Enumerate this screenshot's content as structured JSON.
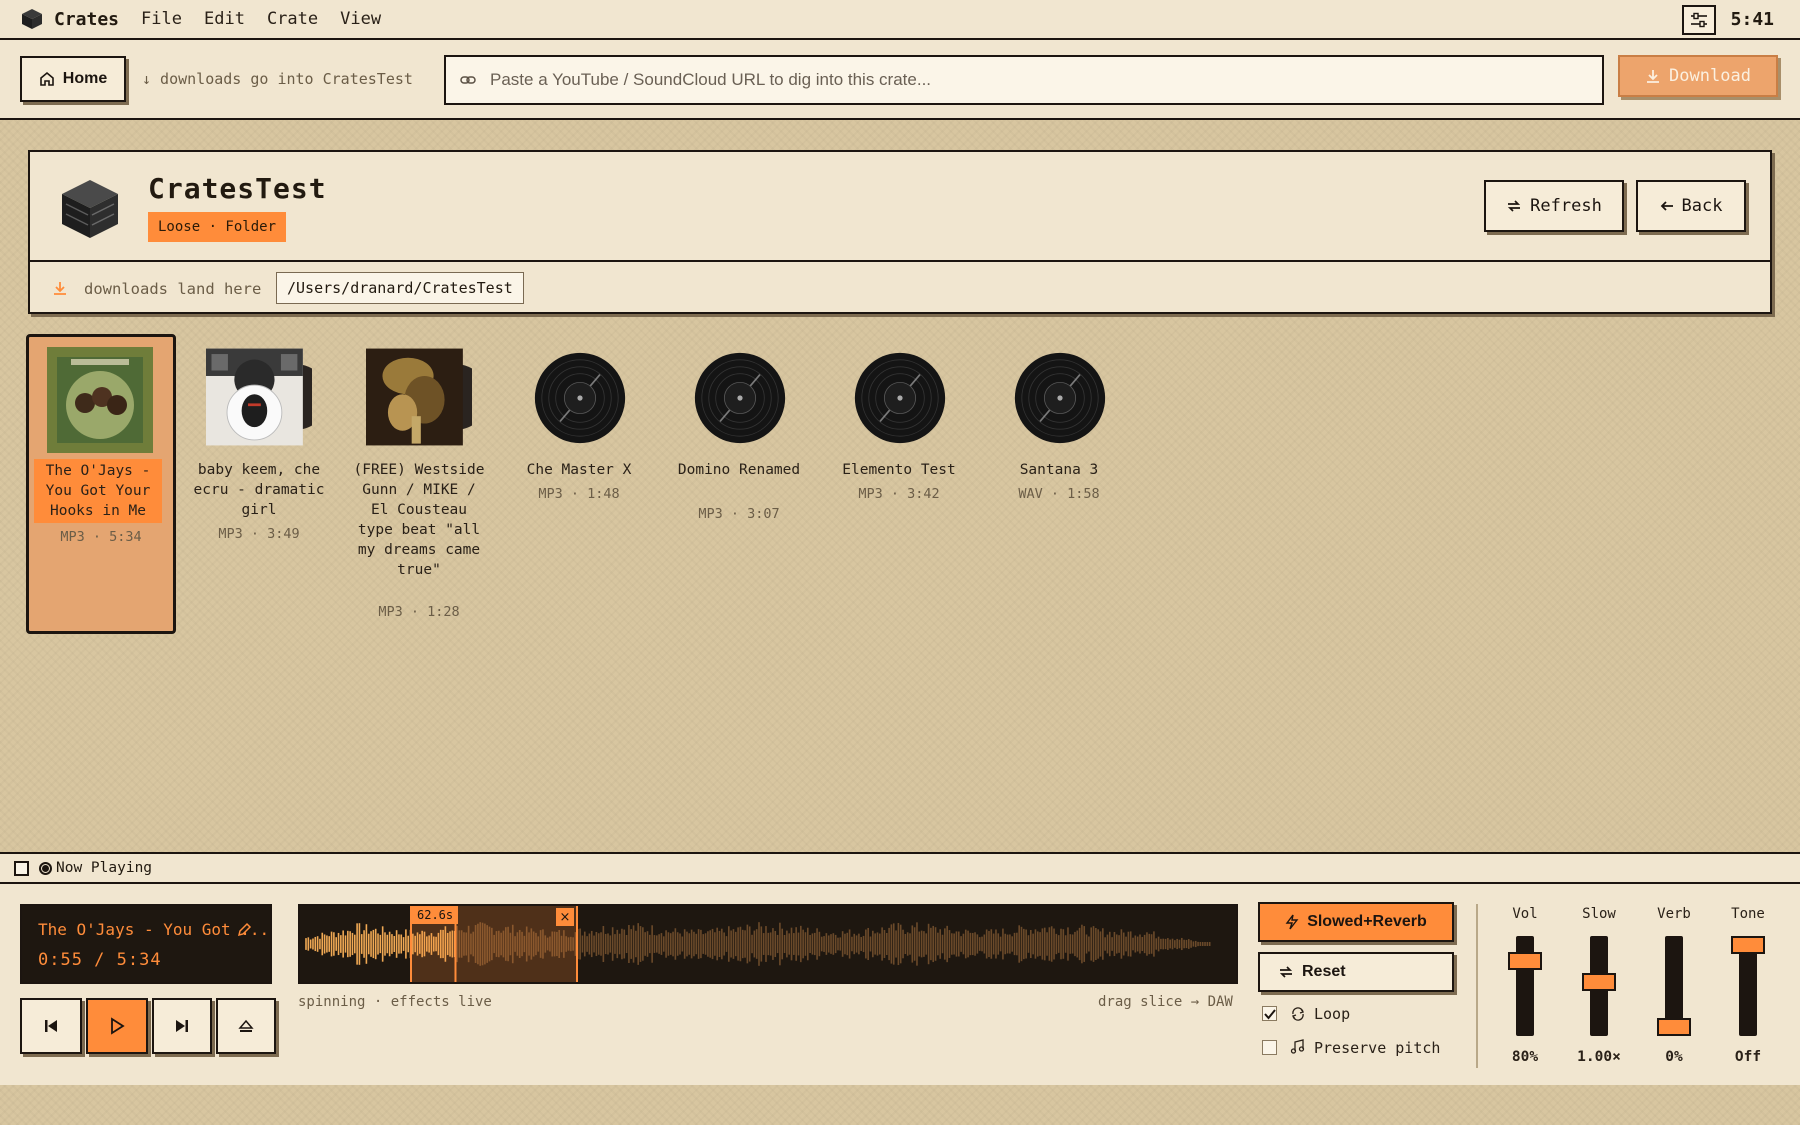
{
  "menubar": {
    "app_name": "Crates",
    "menus": [
      "File",
      "Edit",
      "Crate",
      "View"
    ],
    "clock": "5:41"
  },
  "toolbar": {
    "home_label": "Home",
    "downloads_hint": "↓ downloads go into CratesTest",
    "url_placeholder": "Paste a YouTube / SoundCloud URL to dig into this crate...",
    "download_label": "Download"
  },
  "crate": {
    "title": "CratesTest",
    "badge": "Loose · Folder",
    "refresh_label": "Refresh",
    "back_label": "Back",
    "downloads_label": "downloads land here",
    "path": "/Users/dranard/CratesTest"
  },
  "tracks": [
    {
      "title": "The O'Jays - You Got Your Hooks in Me",
      "meta": "MP3 · 5:34",
      "art": "album-cover",
      "selected": true
    },
    {
      "title": "baby keem, che ecru - dramatic girl",
      "meta": "MP3 · 3:49",
      "art": "album-cover"
    },
    {
      "title": "(FREE) Westside Gunn / MIKE / El Cousteau type beat \"all my dreams came true\"",
      "meta": "MP3 · 1:28",
      "art": "album-cover"
    },
    {
      "title": "Che Master X",
      "meta": "MP3 · 1:48",
      "art": "vinyl-record"
    },
    {
      "title": "Domino Renamed",
      "meta": "MP3 · 3:07",
      "art": "vinyl-record"
    },
    {
      "title": "Elemento Test",
      "meta": "MP3 · 3:42",
      "art": "vinyl-record"
    },
    {
      "title": "Santana 3",
      "meta": "WAV · 1:58",
      "art": "vinyl-record"
    }
  ],
  "now_playing": {
    "header": "Now Playing",
    "title": "The O'Jays - You Got ...",
    "time": "0:55 / 5:34",
    "slice_label": "62.6s",
    "slice_close": "×",
    "status_left": "spinning · effects live",
    "status_right": "drag slice → DAW",
    "playhead_fraction": 0.165
  },
  "effects": {
    "preset_label": "Slowed+Reverb",
    "reset_label": "Reset",
    "loop_label": "Loop",
    "loop_checked": true,
    "preserve_label": "Preserve pitch",
    "preserve_checked": false
  },
  "sliders": [
    {
      "label": "Vol",
      "value": "80%",
      "level": 0.8
    },
    {
      "label": "Slow",
      "value": "1.00×",
      "level": 0.55
    },
    {
      "label": "Verb",
      "value": "0%",
      "level": 0.0
    },
    {
      "label": "Tone",
      "value": "Off",
      "level": 1.0
    }
  ],
  "colors": {
    "accent": "#ff8c3a",
    "ink": "#1c1510",
    "panel": "#f1e6d0",
    "background": "#d8c6a0"
  }
}
